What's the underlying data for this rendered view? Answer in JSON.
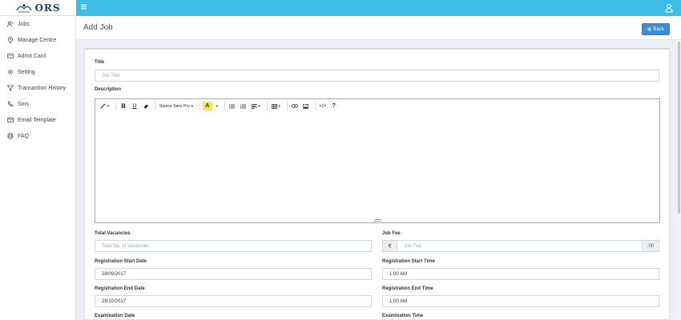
{
  "header": {
    "logo_text": "ORS",
    "menu_icon": "hamburger-icon",
    "user_icon": "user-icon"
  },
  "sidebar": {
    "items": [
      {
        "label": "Jobs",
        "icon": "jobs-icon"
      },
      {
        "label": "Manage Centre",
        "icon": "map-pin-icon"
      },
      {
        "label": "Admit Card",
        "icon": "id-card-icon"
      },
      {
        "label": "Setting",
        "icon": "gear-icon"
      },
      {
        "label": "Transaction History",
        "icon": "filter-icon"
      },
      {
        "label": "Sms",
        "icon": "phone-icon"
      },
      {
        "label": "Email Template",
        "icon": "envelope-icon"
      },
      {
        "label": "FAQ",
        "icon": "globe-icon"
      }
    ]
  },
  "page": {
    "title": "Add Job",
    "back_label": "Back",
    "back_icon": "double-chevron-left-icon"
  },
  "form": {
    "title": {
      "label": "Title",
      "placeholder": "Job Title"
    },
    "description": {
      "label": "Description"
    },
    "editor_toolbar": {
      "style_icon": "magic-wand-icon",
      "bold": "B",
      "underline": "U",
      "clear_icon": "eraser-icon",
      "font_name": "Source Sans Pro",
      "color_letter": "A",
      "ul_icon": "unordered-list-icon",
      "ol_icon": "ordered-list-icon",
      "align_icon": "align-left-icon",
      "table_icon": "table-icon",
      "link_icon": "link-icon",
      "image_icon": "image-icon",
      "code_view": "</>",
      "help": "?"
    },
    "total_vacancies": {
      "label": "Total Vacancies",
      "placeholder": "Total No. of Vacancies"
    },
    "job_fee": {
      "label": "Job Fee",
      "currency": "₹",
      "placeholder": "Job Fee",
      "suffix": ".00"
    },
    "reg_start_date": {
      "label": "Registration Start Date",
      "value": "28/09/2017"
    },
    "reg_start_time": {
      "label": "Registration Start Time",
      "value": "1:00 AM"
    },
    "reg_end_date": {
      "label": "Registration End Date",
      "value": "28/10/2017"
    },
    "reg_end_time": {
      "label": "Registration End Time",
      "value": "1:00 AM"
    },
    "exam_date": {
      "label": "Examination Date"
    },
    "exam_time": {
      "label": "Examination Time"
    }
  },
  "colors": {
    "header": "#3bbde6",
    "primary_button": "#3c8dd8",
    "background": "#ecf0f5"
  }
}
